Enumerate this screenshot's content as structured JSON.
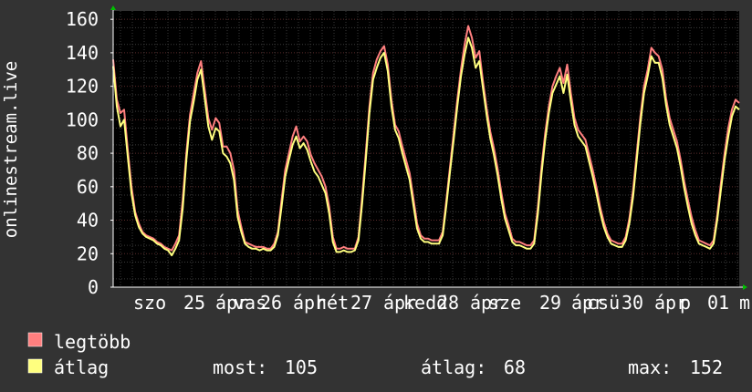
{
  "chart_data": {
    "type": "line",
    "ylabel": "onlinestream.live",
    "ylim": [
      0,
      165
    ],
    "y_ticks": [
      0,
      20,
      40,
      60,
      80,
      100,
      120,
      140,
      160
    ],
    "x_tick_labels": [
      "szo",
      "25",
      "ápr",
      "vas",
      "26",
      "ápr",
      "hét",
      "27",
      "ápr",
      "kedd",
      "28",
      "ápr",
      "sze",
      "29",
      "ápr",
      "csü",
      "30",
      "ápr",
      "p",
      "01",
      "m"
    ],
    "x_step_minutes": 30,
    "grid": true,
    "legend_position": "bottom-left",
    "series": [
      {
        "name": "legtöbb",
        "color": "#ff7f7f",
        "values": [
          136,
          112,
          104,
          106,
          82,
          60,
          45,
          38,
          33,
          31,
          30,
          29,
          27,
          26,
          24,
          23,
          22,
          26,
          31,
          52,
          80,
          103,
          116,
          128,
          135,
          118,
          101,
          94,
          101,
          98,
          84,
          84,
          80,
          70,
          46,
          36,
          27,
          26,
          25,
          24,
          24,
          24,
          23,
          23,
          26,
          33,
          52,
          70,
          80,
          90,
          96,
          87,
          90,
          87,
          79,
          74,
          70,
          66,
          60,
          48,
          30,
          23,
          23,
          24,
          23,
          23,
          23,
          30,
          54,
          80,
          108,
          128,
          136,
          141,
          144,
          133,
          112,
          97,
          93,
          84,
          76,
          68,
          53,
          38,
          31,
          29,
          29,
          28,
          28,
          28,
          33,
          52,
          72,
          92,
          112,
          130,
          145,
          156,
          149,
          137,
          141,
          123,
          107,
          93,
          83,
          71,
          57,
          44,
          37,
          29,
          27,
          27,
          26,
          25,
          25,
          28,
          48,
          72,
          92,
          108,
          120,
          126,
          131,
          122,
          133,
          116,
          101,
          94,
          91,
          88,
          79,
          70,
          60,
          48,
          39,
          32,
          28,
          27,
          26,
          26,
          30,
          41,
          58,
          80,
          102,
          120,
          130,
          143,
          140,
          138,
          130,
          113,
          101,
          94,
          87,
          76,
          63,
          52,
          42,
          34,
          28,
          27,
          26,
          25,
          28,
          43,
          62,
          80,
          95,
          106,
          112,
          110
        ],
        "width": 2
      },
      {
        "name": "átlag",
        "color": "#ffff7f",
        "values": [
          132,
          108,
          96,
          100,
          78,
          56,
          43,
          36,
          32,
          30,
          29,
          28,
          26,
          25,
          23,
          22,
          19,
          23,
          28,
          47,
          76,
          99,
          111,
          124,
          130,
          113,
          96,
          88,
          95,
          93,
          80,
          78,
          74,
          64,
          42,
          33,
          26,
          24,
          23,
          23,
          22,
          23,
          22,
          22,
          24,
          31,
          48,
          66,
          76,
          85,
          90,
          83,
          86,
          82,
          75,
          69,
          66,
          61,
          56,
          44,
          27,
          21,
          21,
          22,
          21,
          21,
          22,
          28,
          50,
          76,
          104,
          124,
          131,
          137,
          140,
          129,
          108,
          94,
          89,
          80,
          72,
          64,
          49,
          35,
          29,
          27,
          27,
          26,
          26,
          26,
          31,
          49,
          69,
          88,
          108,
          126,
          139,
          149,
          143,
          131,
          135,
          119,
          103,
          89,
          79,
          67,
          53,
          41,
          34,
          27,
          25,
          25,
          24,
          23,
          23,
          26,
          44,
          68,
          88,
          104,
          116,
          121,
          126,
          116,
          127,
          111,
          97,
          90,
          87,
          84,
          75,
          66,
          56,
          45,
          36,
          30,
          26,
          25,
          24,
          24,
          28,
          38,
          54,
          76,
          98,
          116,
          126,
          138,
          134,
          134,
          125,
          109,
          97,
          90,
          83,
          72,
          59,
          48,
          38,
          31,
          26,
          25,
          24,
          23,
          26,
          40,
          58,
          76,
          90,
          102,
          108,
          106
        ],
        "width": 2
      }
    ]
  },
  "stats": [
    {
      "label": "most:",
      "value": "105"
    },
    {
      "label": "átlag:",
      "value": "68"
    },
    {
      "label": "max:",
      "value": "152"
    }
  ],
  "colors": {
    "background": "#333333",
    "plot_background": "#000000",
    "grid_minor": "#3a3a3a",
    "grid_major": "#5a2a2a",
    "axis": "#ffffff",
    "arrow": "#00c000"
  }
}
